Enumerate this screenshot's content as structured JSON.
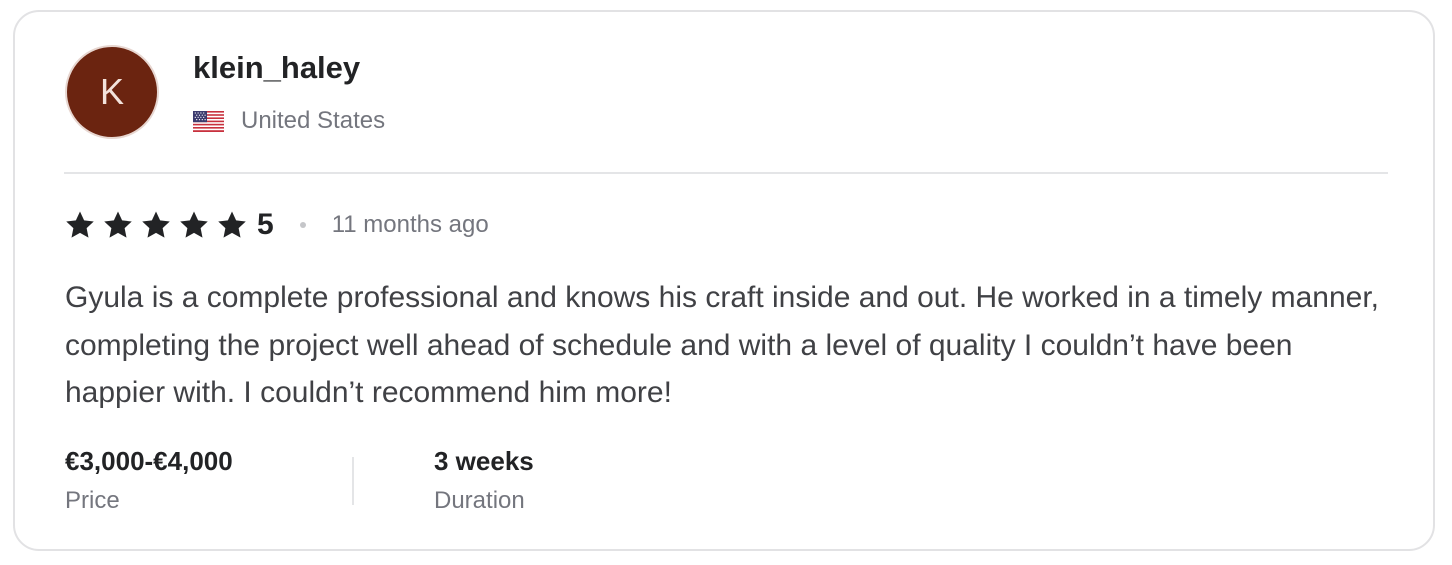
{
  "review": {
    "avatar_initial": "K",
    "username": "klein_haley",
    "country": "United States",
    "flag_icon": "us-flag-icon",
    "rating": {
      "stars": 5,
      "max_stars": 5,
      "value": "5",
      "star_color": "#222325"
    },
    "time_ago": "11 months ago",
    "text": "Gyula is a complete professional and knows his craft inside and out. He worked in a timely manner, completing the project well ahead of schedule and with a level of quality I couldn’t have been happier with. I couldn’t recommend him more!",
    "price": {
      "value": "€3,000-€4,000",
      "label": "Price"
    },
    "duration": {
      "value": "3 weeks",
      "label": "Duration"
    }
  },
  "colors": {
    "avatar_bg": "#6b2410",
    "text_primary": "#222325",
    "text_secondary": "#74767e",
    "border": "#e2e2e4"
  }
}
